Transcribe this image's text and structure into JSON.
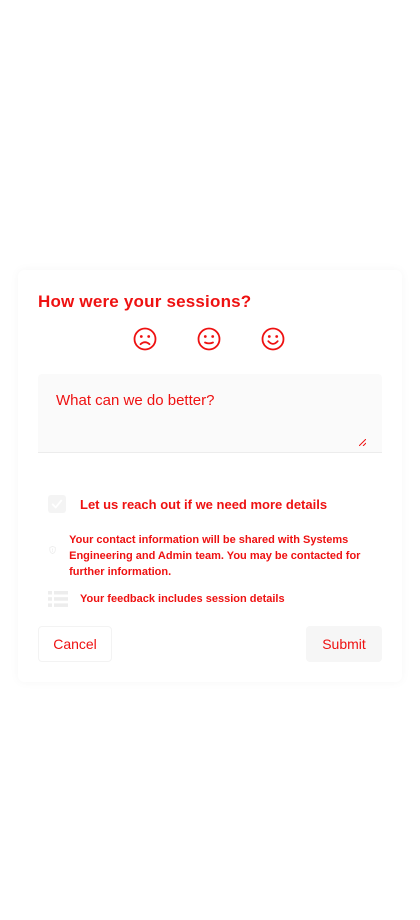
{
  "dialog": {
    "title": "How were your sessions?",
    "rating": {
      "options": [
        "sad-face",
        "neutral-face",
        "happy-face"
      ]
    },
    "feedback": {
      "placeholder": "What can we do better?",
      "value": ""
    },
    "contact_checkbox": {
      "label": "Let us reach out if we need more details",
      "checked": true
    },
    "privacy_notice": "Your contact information will be shared with Systems Engineering and Admin team. You may be contacted for further information.",
    "session_details_notice": "Your feedback includes session details",
    "buttons": {
      "cancel": "Cancel",
      "submit": "Submit"
    }
  },
  "colors": {
    "text": "#ee1111",
    "icon": "#ededed",
    "field_bg": "#fafafa"
  }
}
